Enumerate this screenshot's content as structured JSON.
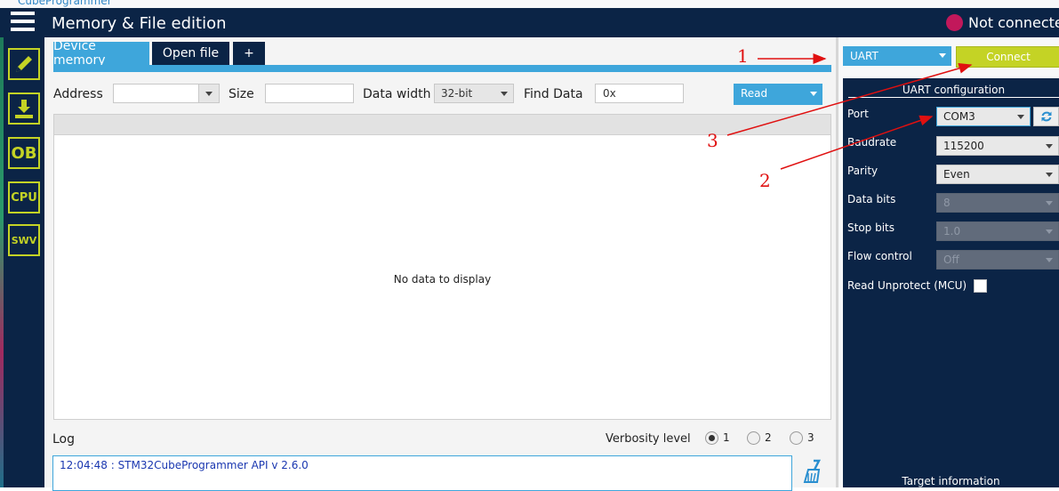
{
  "app": {
    "name": "CubeProgrammer"
  },
  "header": {
    "title": "Memory & File edition",
    "status": "Not connected",
    "status_color": "#c2185b"
  },
  "sidebar": {
    "items": [
      {
        "name": "memory-edit",
        "icon": "pencil-icon",
        "label": ""
      },
      {
        "name": "erase-program",
        "icon": "download-icon",
        "label": ""
      },
      {
        "name": "option-bytes",
        "icon": "ob-icon",
        "label": "OB"
      },
      {
        "name": "cpu",
        "icon": "cpu-icon",
        "label": "CPU"
      },
      {
        "name": "swv",
        "icon": "swv-icon",
        "label": "SWV"
      }
    ]
  },
  "tabs": [
    {
      "label": "Device memory",
      "active": true
    },
    {
      "label": "Open file",
      "active": false
    },
    {
      "label": "+",
      "active": false
    }
  ],
  "toolbar": {
    "address_label": "Address",
    "address_value": "",
    "size_label": "Size",
    "size_value": "",
    "data_width_label": "Data width",
    "data_width_value": "32-bit",
    "find_label": "Find Data",
    "find_value": "0x",
    "read_label": "Read"
  },
  "grid": {
    "empty_text": "No data to display"
  },
  "log": {
    "label": "Log",
    "verbosity_label": "Verbosity level",
    "levels": [
      "1",
      "2",
      "3"
    ],
    "selected_level": "1",
    "lines": [
      "12:04:48 : STM32CubeProgrammer API v 2.6.0"
    ]
  },
  "connection": {
    "interface": "UART",
    "connect_label": "Connect",
    "config_title": "UART configuration",
    "fields": [
      {
        "label": "Port",
        "value": "COM3",
        "enabled": true
      },
      {
        "label": "Baudrate",
        "value": "115200",
        "enabled": true
      },
      {
        "label": "Parity",
        "value": "Even",
        "enabled": true
      },
      {
        "label": "Data bits",
        "value": "8",
        "enabled": false
      },
      {
        "label": "Stop bits",
        "value": "1.0",
        "enabled": false
      },
      {
        "label": "Flow control",
        "value": "Off",
        "enabled": false
      }
    ],
    "read_unprotect_label": "Read Unprotect (MCU)",
    "target_info_label": "Target information"
  },
  "annotations": {
    "labels": [
      "1",
      "2",
      "3"
    ],
    "color": "#e01010"
  },
  "colors": {
    "navy": "#0b2446",
    "accent": "#3ea6db",
    "lime": "#c4d325"
  }
}
